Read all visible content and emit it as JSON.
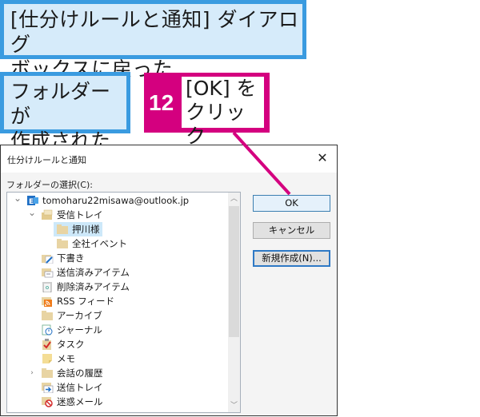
{
  "callouts": {
    "dialog_returned": {
      "line1": "[仕分けルールと通知] ダイアログ",
      "line2": "ボックスに戻った"
    },
    "folder_created": {
      "line1": "フォルダーが",
      "line2": "作成された"
    },
    "step": {
      "number": "12",
      "line1": "[OK] を",
      "line2": "クリック"
    }
  },
  "colors": {
    "blue_callout_border": "#3a9be0",
    "blue_callout_fill": "#d6ebfa",
    "step_magenta": "#d4007f"
  },
  "dialog": {
    "title": "仕分けルールと通知",
    "close_glyph": "✕",
    "folder_select_label": "フォルダーの選択(C):",
    "buttons": {
      "ok": "OK",
      "cancel": "キャンセル",
      "new_folder": "新規作成(N)..."
    },
    "tree": {
      "items": [
        {
          "label": "tomoharu22misawa@outlook.jp",
          "icon": "exchange-account-icon",
          "expander": "expanded",
          "level": 0
        },
        {
          "label": "受信トレイ",
          "icon": "inbox-icon",
          "expander": "expanded",
          "level": 1
        },
        {
          "label": "押川様",
          "icon": "folder-icon",
          "level": 2,
          "selected": true
        },
        {
          "label": "全社イベント",
          "icon": "folder-icon",
          "level": 2
        },
        {
          "label": "下書き",
          "icon": "drafts-icon",
          "level": 1
        },
        {
          "label": "送信済みアイテム",
          "icon": "sent-items-icon",
          "level": 1
        },
        {
          "label": "削除済みアイテム",
          "icon": "trash-icon",
          "level": 1
        },
        {
          "label": "RSS フィード",
          "icon": "rss-icon",
          "level": 1
        },
        {
          "label": "アーカイブ",
          "icon": "folder-icon",
          "level": 1
        },
        {
          "label": "ジャーナル",
          "icon": "journal-icon",
          "level": 1
        },
        {
          "label": "タスク",
          "icon": "tasks-icon",
          "level": 1
        },
        {
          "label": "メモ",
          "icon": "notes-icon",
          "level": 1
        },
        {
          "label": "会話の履歴",
          "icon": "folder-icon",
          "expander": "collapsed",
          "level": 1
        },
        {
          "label": "送信トレイ",
          "icon": "outbox-icon",
          "level": 1
        },
        {
          "label": "迷惑メール",
          "icon": "junk-icon",
          "level": 1
        }
      ]
    }
  },
  "scrollbar": {
    "up_glyph": "︿",
    "down_glyph": "﹀"
  },
  "tree_glyphs": {
    "expanded": "⌄",
    "collapsed": "›"
  }
}
